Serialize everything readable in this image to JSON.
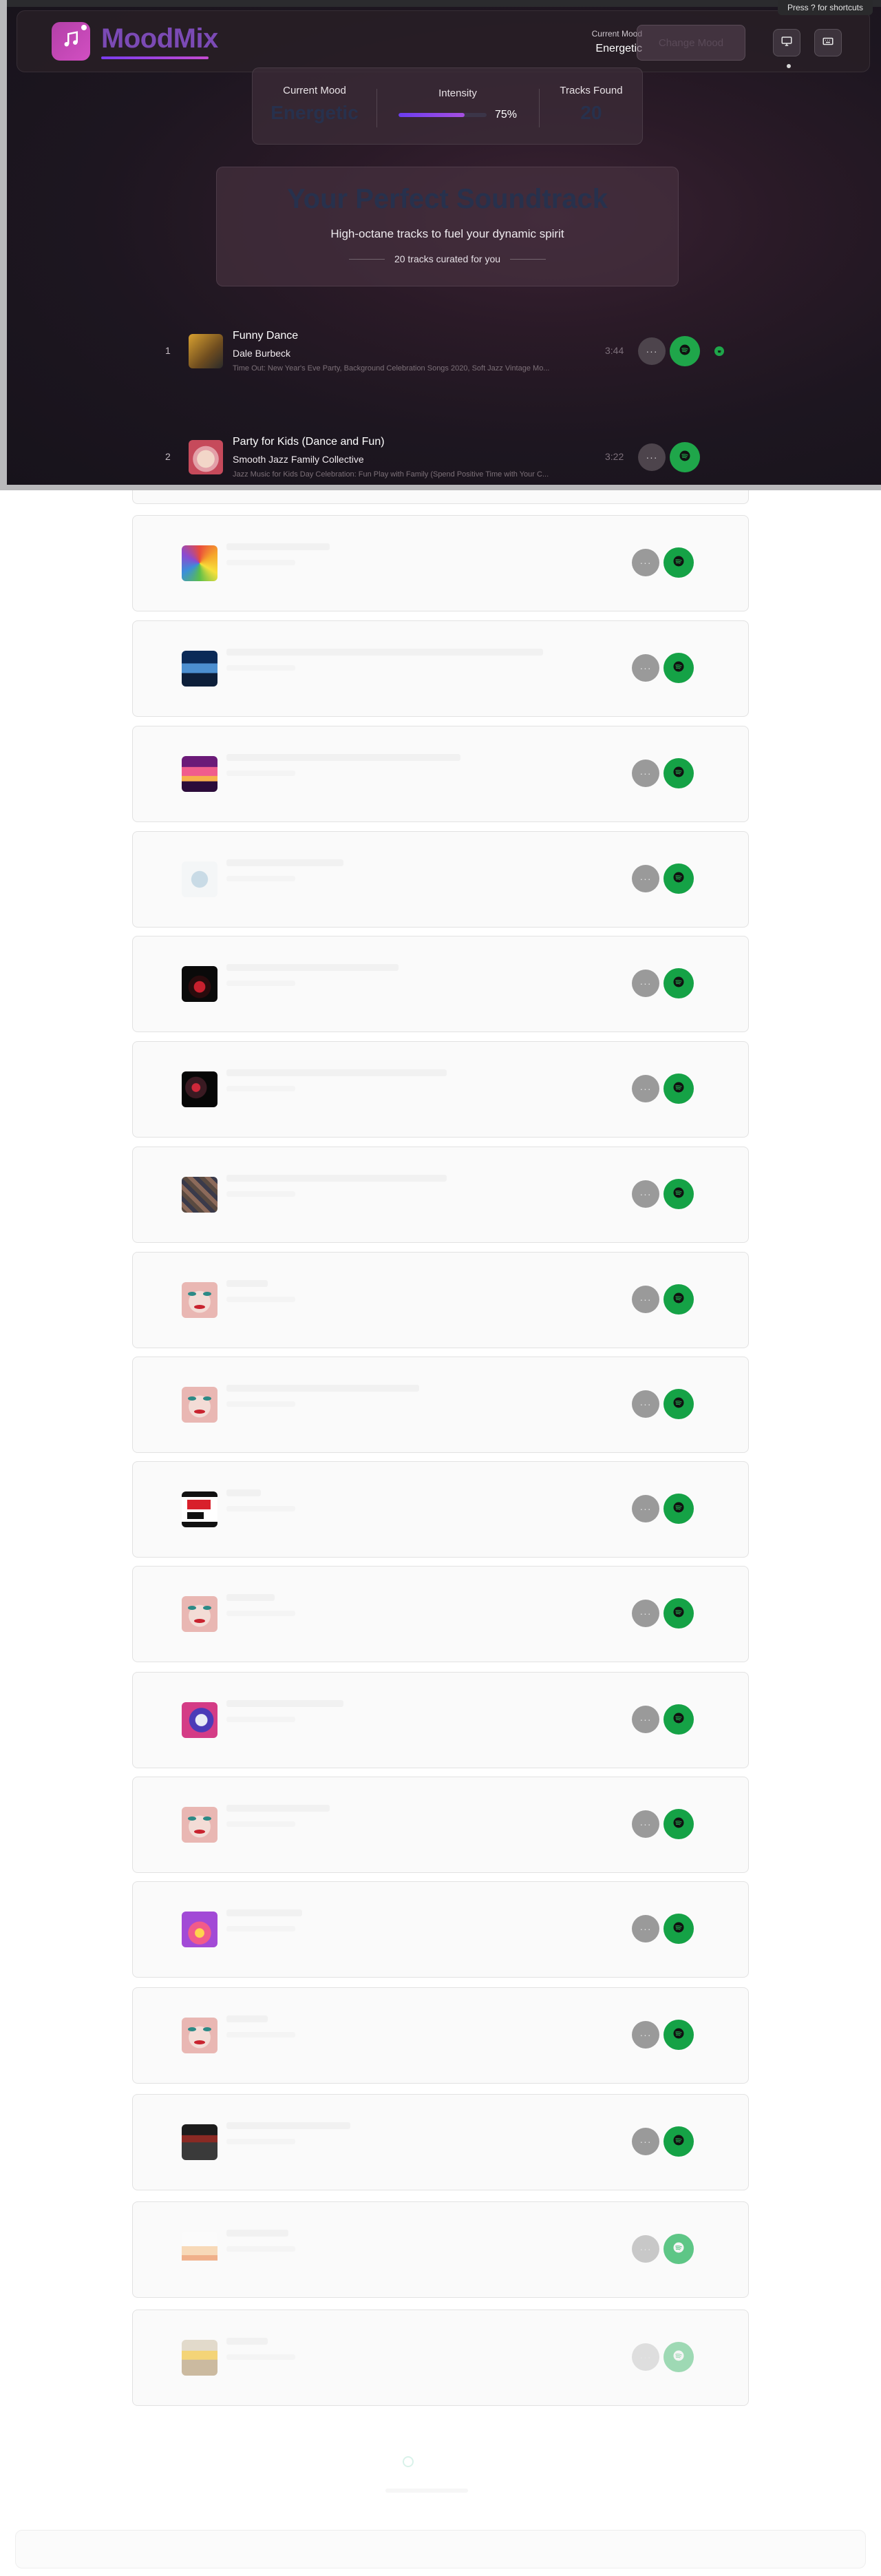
{
  "shortcut_hint": "Press ? for shortcuts",
  "app": {
    "name": "MoodMix"
  },
  "nav": {
    "current_mood_label": "Current Mood",
    "current_mood_value": "Energetic",
    "change_mood_label": "Change Mood"
  },
  "stats": {
    "mood_label": "Current Mood",
    "mood_value": "Energetic",
    "intensity_label": "Intensity",
    "intensity_value": "75%",
    "intensity_fraction": 0.75,
    "tracks_label": "Tracks Found",
    "tracks_value": "20"
  },
  "header": {
    "title": "Your Perfect Soundtrack",
    "subtitle": "High-octane tracks to fuel your dynamic spirit",
    "curated": "20 tracks curated for you"
  },
  "tracks": [
    {
      "number": "1",
      "title": "Funny Dance",
      "artist": "Dale Burbeck",
      "meta": "Time Out: New Year's Eve Party, Background Celebration Songs 2020, Soft Jazz Vintage Mo...",
      "duration": "3:44",
      "more_label": "···"
    },
    {
      "number": "2",
      "title": "Party for Kids (Dance and Fun)",
      "artist": "Smooth Jazz Family Collective",
      "meta": "Jazz Music for Kids Day Celebration: Fun Play with Family (Spend Positive Time with Your C...",
      "duration": "3:22",
      "more_label": "···"
    }
  ],
  "list_more_label": "···",
  "colors": {
    "accent": "#7b4ab5",
    "spotify_green": "#1fa64a",
    "hero_bg": "#1d1620"
  },
  "icons": {
    "logo": "music-note-icon",
    "desktop": "monitor-icon",
    "keyboard": "keyboard-icon",
    "spotify": "spotify-icon"
  }
}
